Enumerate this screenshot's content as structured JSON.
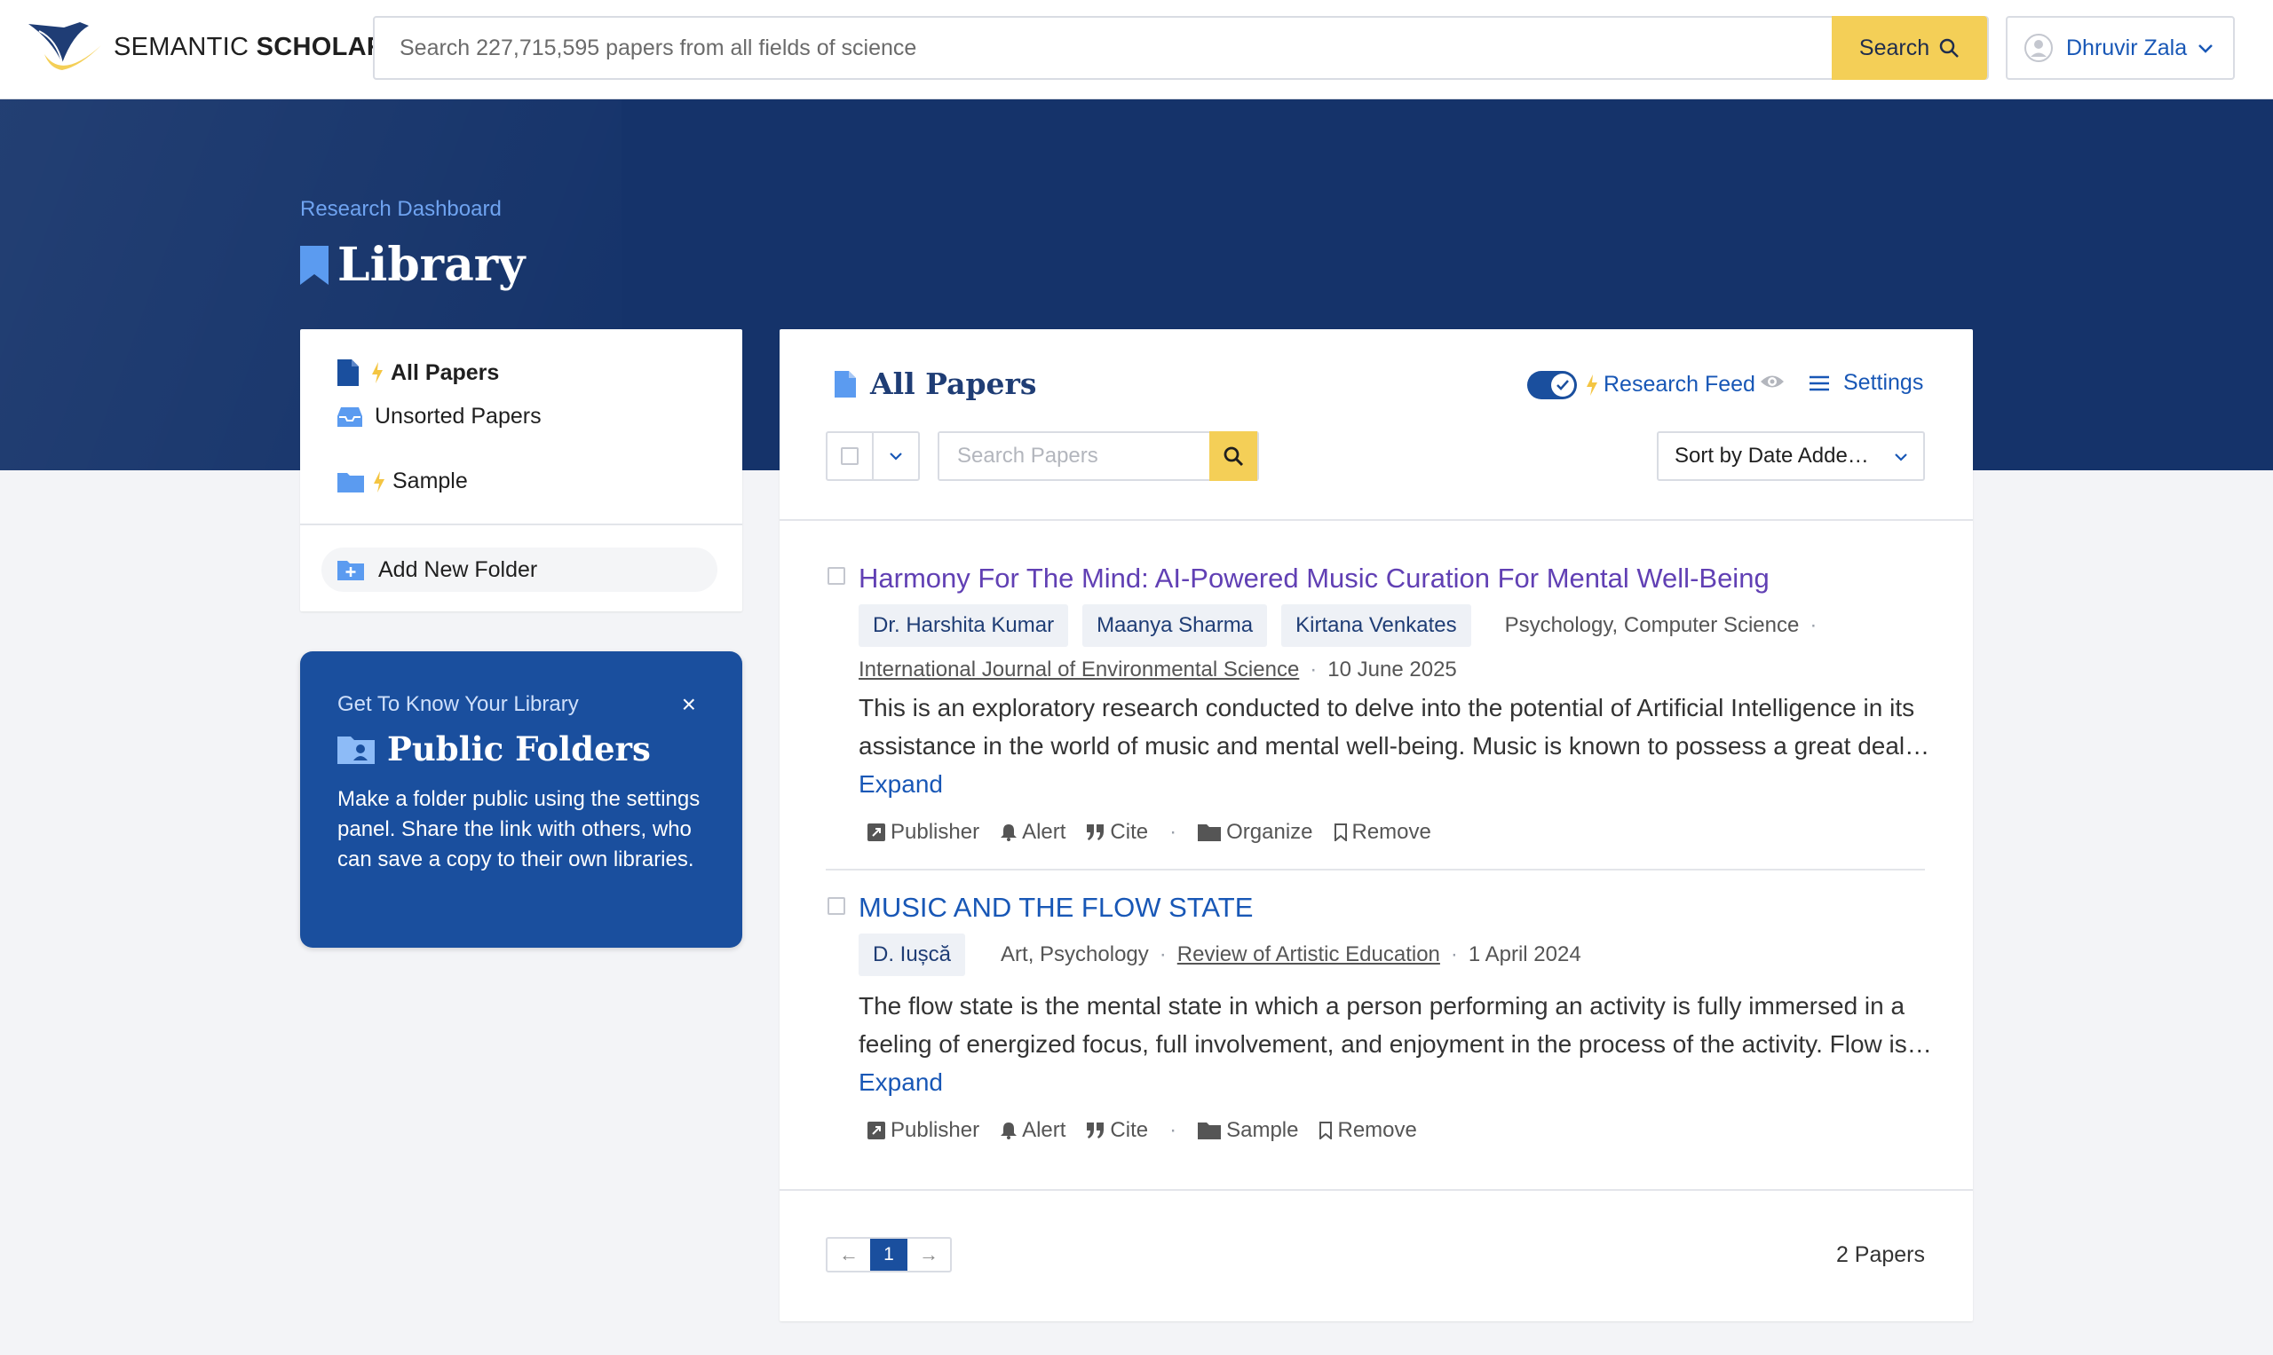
{
  "header": {
    "logo_light": "SEMANTIC ",
    "logo_bold": "SCHOLAR",
    "search_placeholder": "Search 227,715,595 papers from all fields of science",
    "search_label": "Search",
    "user_name": "Dhruvir Zala"
  },
  "hero": {
    "breadcrumb": "Research Dashboard",
    "title": "Library"
  },
  "sidebar": {
    "items": [
      {
        "label": "All Papers",
        "icon": "file-icon",
        "active": true
      },
      {
        "label": "Unsorted Papers",
        "icon": "inbox-icon",
        "active": false
      },
      {
        "label": "Sample",
        "icon": "folder-icon",
        "active": false
      }
    ],
    "add_folder": "Add New Folder"
  },
  "info_card": {
    "kicker": "Get To Know Your Library",
    "title": "Public Folders",
    "body": "Make a folder public using the settings panel. Share the link with others, who can save a copy to their own libraries.",
    "close": "×"
  },
  "main": {
    "title": "All Papers",
    "feed_label": "Research Feed",
    "feed_on": true,
    "settings_label": "Settings",
    "search_placeholder": "Search Papers",
    "sort_label": "Sort by Date Adde…",
    "papers": [
      {
        "title": "Harmony For The Mind: AI-Powered Music Curation For Mental Well-Being",
        "authors": [
          "Dr. Harshita Kumar",
          "Maanya Sharma",
          "Kirtana Venkates"
        ],
        "fields": "Psychology, Computer Science",
        "venue": "International Journal of Environmental Science",
        "date": "10 June 2025",
        "abstract": "This is an exploratory research conducted to delve into the potential of Artificial Intelligence in its assistance in the world of music and mental well-being. Music is known to possess a great deal…",
        "expand": "Expand",
        "actions": {
          "publisher": "Publisher",
          "alert": "Alert",
          "cite": "Cite",
          "folder": "Organize",
          "remove": "Remove"
        }
      },
      {
        "title": "MUSIC AND THE FLOW STATE",
        "authors": [
          "D. Iușcă"
        ],
        "fields": "Art, Psychology",
        "venue": "Review of Artistic Education",
        "date": "1 April 2024",
        "abstract": "The flow state is the mental state in which a person performing an activity is fully immersed in a feeling of energized focus, full involvement, and enjoyment in the process of the activity. Flow is…",
        "expand": "Expand",
        "actions": {
          "publisher": "Publisher",
          "alert": "Alert",
          "cite": "Cite",
          "folder": "Sample",
          "remove": "Remove"
        }
      }
    ],
    "pager": {
      "prev": "←",
      "page": "1",
      "next": "→"
    },
    "count": "2 Papers"
  },
  "colors": {
    "brand_navy": "#15336a",
    "accent_blue": "#1857b6",
    "search_yellow": "#f4cf57",
    "title_purple": "#6140b4"
  }
}
